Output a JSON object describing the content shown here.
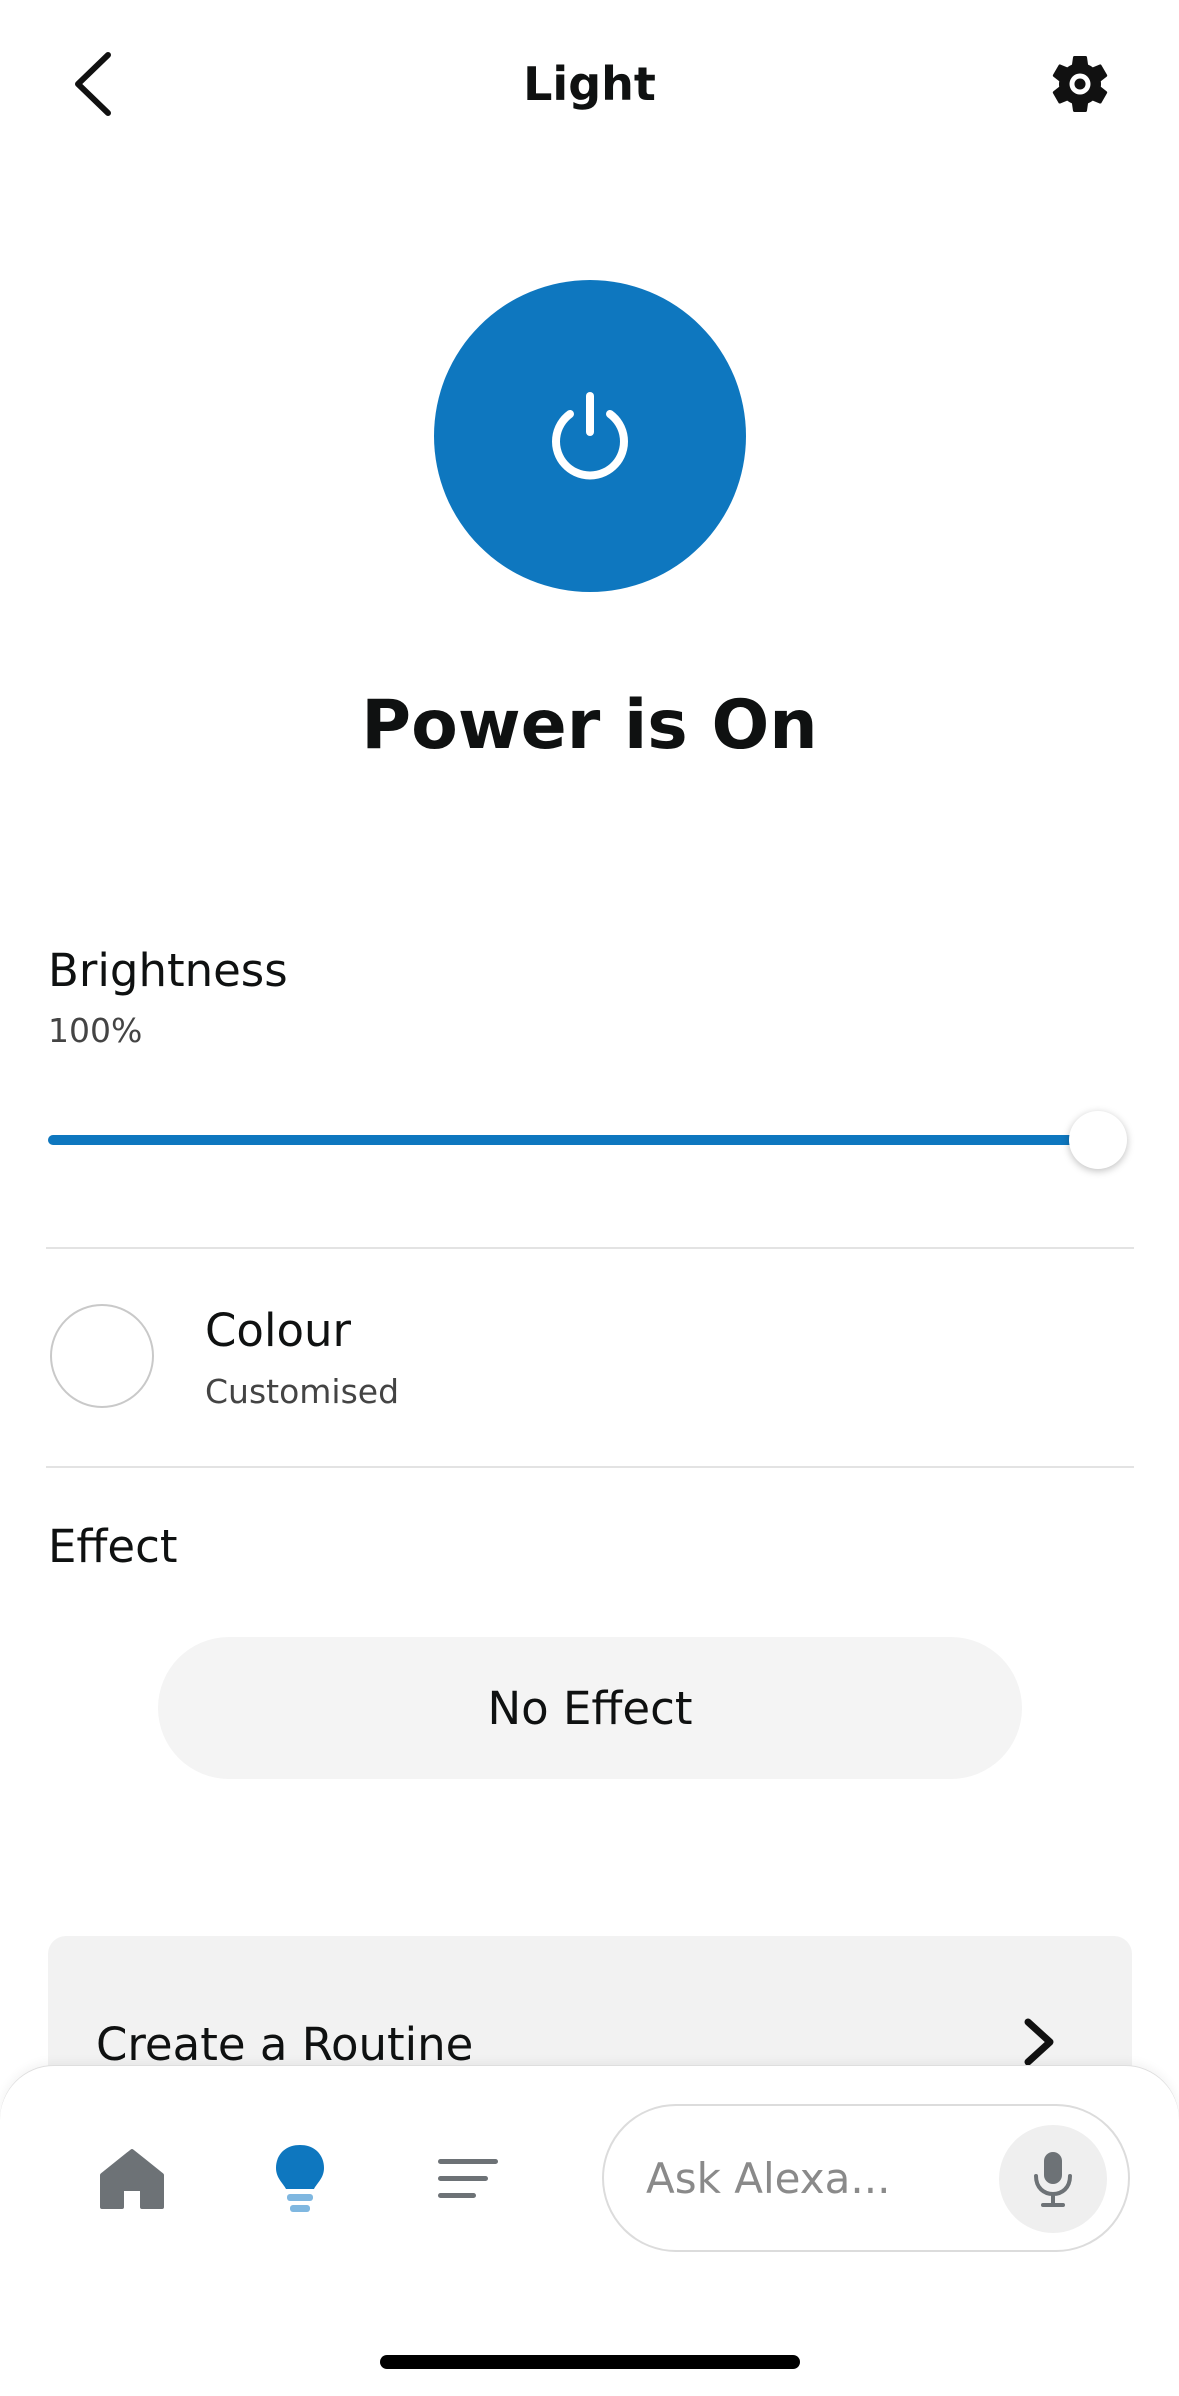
{
  "header": {
    "title": "Light",
    "back_icon": "chevron-left-icon",
    "settings_icon": "gear-icon"
  },
  "power": {
    "icon": "power-icon",
    "status": "Power is On",
    "accent_color": "#0e77bf"
  },
  "brightness": {
    "label": "Brightness",
    "value_text": "100%",
    "level": 1.0
  },
  "colour": {
    "label": "Colour",
    "value": "Customised"
  },
  "effect": {
    "label": "Effect",
    "button_label": "No Effect"
  },
  "routine": {
    "label": "Create a Routine",
    "icon": "chevron-right-icon"
  },
  "bottom_nav": {
    "items": [
      {
        "name": "home",
        "icon": "home-icon"
      },
      {
        "name": "devices",
        "icon": "lightbulb-icon"
      },
      {
        "name": "more",
        "icon": "menu-icon"
      }
    ],
    "ask_placeholder": "Ask Alexa...",
    "mic_icon": "microphone-icon"
  }
}
